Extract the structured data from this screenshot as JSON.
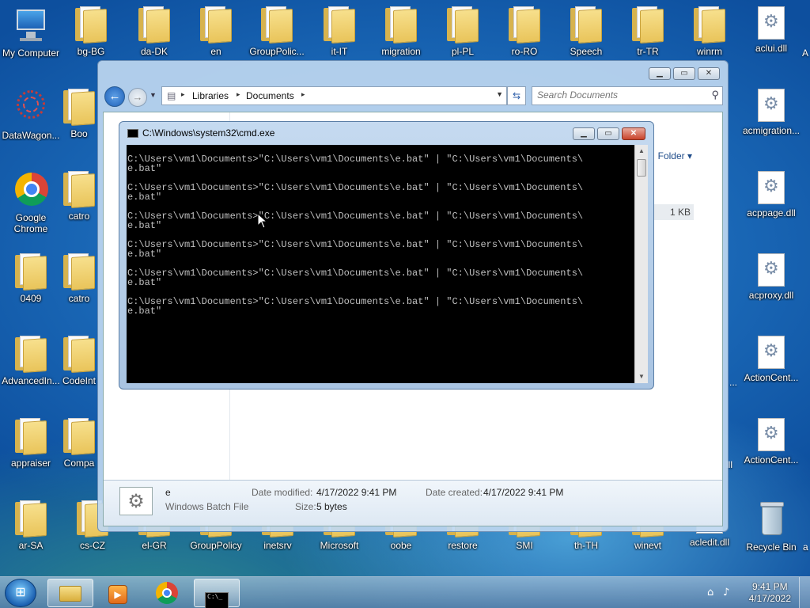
{
  "desktop": {
    "icons": [
      {
        "label": "My Computer",
        "icon": "computer-icon"
      },
      {
        "label": "bg-BG",
        "icon": "folder-icon"
      },
      {
        "label": "da-DK",
        "icon": "folder-icon"
      },
      {
        "label": "en",
        "icon": "folder-icon"
      },
      {
        "label": "GroupPolic...",
        "icon": "folder-icon"
      },
      {
        "label": "it-IT",
        "icon": "folder-icon"
      },
      {
        "label": "migration",
        "icon": "folder-icon"
      },
      {
        "label": "pl-PL",
        "icon": "folder-icon"
      },
      {
        "label": "ro-RO",
        "icon": "folder-icon"
      },
      {
        "label": "Speech",
        "icon": "folder-icon"
      },
      {
        "label": "tr-TR",
        "icon": "folder-icon"
      },
      {
        "label": "winrm",
        "icon": "folder-icon"
      },
      {
        "label": "aclui.dll",
        "icon": "dll-icon"
      },
      {
        "label": "DataWagon...",
        "icon": "datawagon-icon"
      },
      {
        "label": "Boo",
        "icon": "folder-icon"
      },
      {
        "label": "acmigration...",
        "icon": "dll-icon"
      },
      {
        "label": "Google Chrome",
        "icon": "chrome-icon"
      },
      {
        "label": "catro",
        "icon": "folder-icon"
      },
      {
        "label": "acppage.dll",
        "icon": "dll-icon"
      },
      {
        "label": "0409",
        "icon": "folder-icon"
      },
      {
        "label": "catro",
        "icon": "folder-icon"
      },
      {
        "label": "acproxy.dll",
        "icon": "dll-icon"
      },
      {
        "label": "AdvancedIn...",
        "icon": "folder-icon"
      },
      {
        "label": "CodeInt",
        "icon": "folder-icon"
      },
      {
        "label": "ActionCent...",
        "icon": "dll-icon"
      },
      {
        "label": "appraiser",
        "icon": "folder-icon"
      },
      {
        "label": "Compa",
        "icon": "folder-icon"
      },
      {
        "label": "ActionCent...",
        "icon": "dll-icon"
      },
      {
        "label": "ar-SA",
        "icon": "folder-icon"
      },
      {
        "label": "cs-CZ",
        "icon": "folder-icon"
      },
      {
        "label": "el-GR",
        "icon": "folder-icon"
      },
      {
        "label": "GroupPolicy",
        "icon": "folder-icon"
      },
      {
        "label": "inetsrv",
        "icon": "folder-icon"
      },
      {
        "label": "Microsoft",
        "icon": "folder-icon"
      },
      {
        "label": "oobe",
        "icon": "folder-icon"
      },
      {
        "label": "restore",
        "icon": "folder-icon"
      },
      {
        "label": "SMI",
        "icon": "folder-icon"
      },
      {
        "label": "th-TH",
        "icon": "folder-icon"
      },
      {
        "label": "winevt",
        "icon": "folder-icon"
      },
      {
        "label": "acledit.dll",
        "icon": "dll-icon"
      },
      {
        "label": "Recycle Bin",
        "icon": "recycle-bin-icon"
      }
    ],
    "edge_fragments": [
      "A",
      "...",
      "lll",
      "a"
    ]
  },
  "explorer": {
    "breadcrumb": [
      "Libraries",
      "Documents"
    ],
    "search_placeholder": "Search Documents",
    "folder_button": "Folder",
    "size_cell": "1 KB",
    "details": {
      "name": "e",
      "type": "Windows Batch File",
      "date_modified_label": "Date modified:",
      "date_modified": "4/17/2022 9:41 PM",
      "date_created_label": "Date created:",
      "date_created": "4/17/2022 9:41 PM",
      "size_label": "Size:",
      "size": "5 bytes"
    }
  },
  "cmd": {
    "title": "C:\\Windows\\system32\\cmd.exe",
    "line1": "C:\\Users\\vm1\\Documents>\"C:\\Users\\vm1\\Documents\\e.bat\" | \"C:\\Users\\vm1\\Documents\\",
    "line2": "e.bat\""
  },
  "taskbar": {
    "time": "9:41 PM",
    "date": "4/17/2022"
  }
}
